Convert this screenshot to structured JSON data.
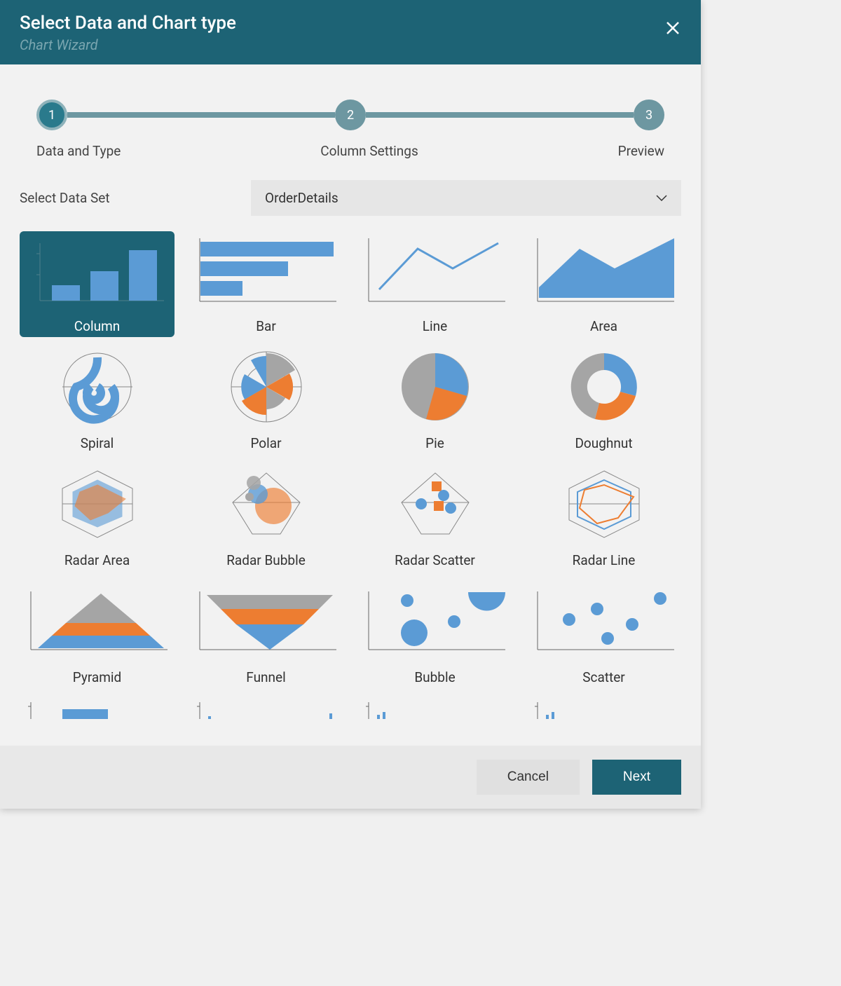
{
  "header": {
    "title": "Select Data and Chart type",
    "subtitle": "Chart Wizard"
  },
  "steps": {
    "s1": "1",
    "s2": "2",
    "s3": "3",
    "l1": "Data and Type",
    "l2": "Column Settings",
    "l3": "Preview"
  },
  "dataset": {
    "label": "Select Data Set",
    "value": "OrderDetails"
  },
  "chartTypes": {
    "column": "Column",
    "bar": "Bar",
    "line": "Line",
    "area": "Area",
    "spiral": "Spiral",
    "polar": "Polar",
    "pie": "Pie",
    "doughnut": "Doughnut",
    "radarArea": "Radar Area",
    "radarBubble": "Radar Bubble",
    "radarScatter": "Radar Scatter",
    "radarLine": "Radar Line",
    "pyramid": "Pyramid",
    "funnel": "Funnel",
    "bubble": "Bubble",
    "scatter": "Scatter"
  },
  "footer": {
    "cancel": "Cancel",
    "next": "Next"
  },
  "colors": {
    "accent": "#1d6375",
    "blue": "#5b9bd5",
    "orange": "#ed7d31",
    "gray": "#a5a5a5"
  }
}
